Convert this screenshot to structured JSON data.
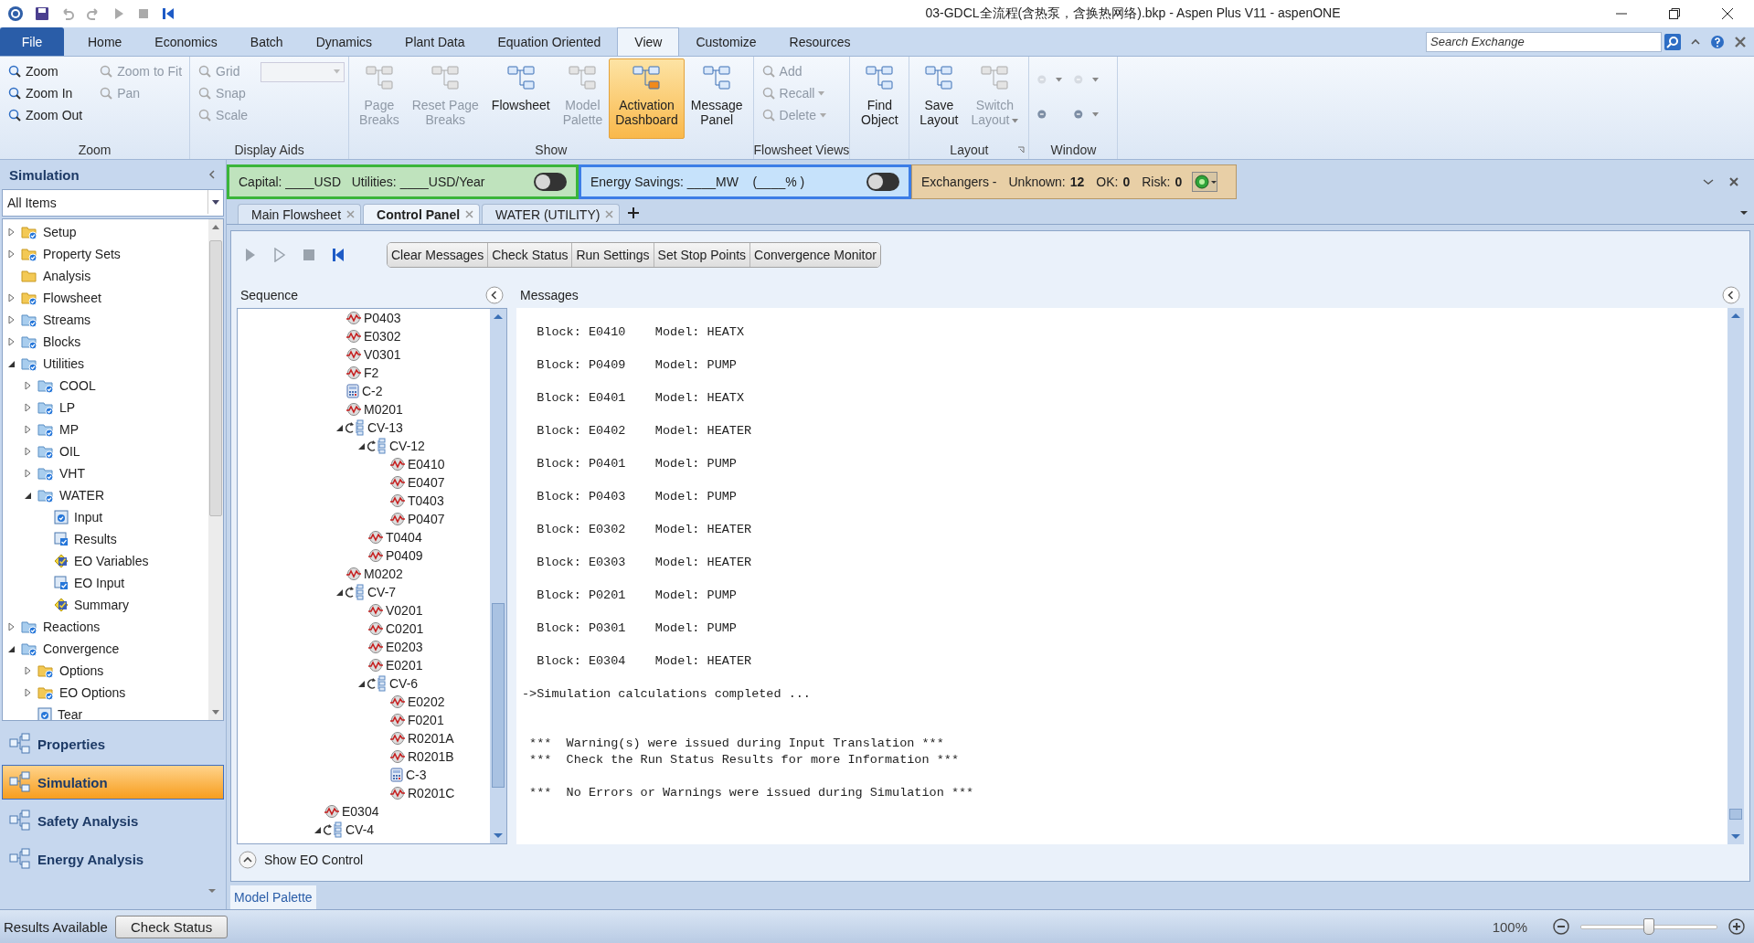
{
  "window": {
    "title": "03-GDCL全流程(含热泵，含换热网络).bkp - Aspen Plus V11 - aspenONE"
  },
  "ribbon_tabs": [
    {
      "label": "File",
      "kind": "file",
      "selected": false
    },
    {
      "label": "Home",
      "kind": "tab",
      "selected": false
    },
    {
      "label": "Economics",
      "kind": "tab",
      "selected": false
    },
    {
      "label": "Batch",
      "kind": "tab",
      "selected": false
    },
    {
      "label": "Dynamics",
      "kind": "tab",
      "selected": false
    },
    {
      "label": "Plant Data",
      "kind": "tab",
      "selected": false
    },
    {
      "label": "Equation Oriented",
      "kind": "tab",
      "selected": false
    },
    {
      "label": "View",
      "kind": "tab",
      "selected": true
    },
    {
      "label": "Customize",
      "kind": "tab",
      "selected": false
    },
    {
      "label": "Resources",
      "kind": "tab",
      "selected": false
    }
  ],
  "search": {
    "placeholder": "Search Exchange"
  },
  "ribbon_groups": [
    {
      "label": "Zoom",
      "kind": "small",
      "items": [
        {
          "label": "Zoom",
          "disabled": false
        },
        {
          "label": "Zoom In",
          "disabled": false
        },
        {
          "label": "Zoom Out",
          "disabled": false
        },
        {
          "label": "Zoom to Fit",
          "disabled": true
        },
        {
          "label": "Pan",
          "disabled": true
        }
      ]
    },
    {
      "label": "Display Aids",
      "kind": "small",
      "items": [
        {
          "label": "Grid",
          "disabled": true
        },
        {
          "label": "Snap",
          "disabled": true
        },
        {
          "label": "Scale",
          "disabled": true
        },
        {
          "kind": "combo",
          "disabled": true
        }
      ]
    },
    {
      "label": "Show",
      "kind": "large",
      "items": [
        {
          "label": "Page\nBreaks",
          "disabled": true,
          "selected": false
        },
        {
          "label": "Reset Page\nBreaks",
          "disabled": true,
          "selected": false
        },
        {
          "label": "Flowsheet",
          "disabled": false,
          "selected": false
        },
        {
          "label": "Model\nPalette",
          "disabled": true,
          "selected": false
        },
        {
          "label": "Activation\nDashboard",
          "disabled": false,
          "selected": true
        },
        {
          "label": "Message\nPanel",
          "disabled": false,
          "selected": false
        }
      ]
    },
    {
      "label": "Flowsheet Views",
      "kind": "small",
      "items": [
        {
          "label": "Add",
          "disabled": true
        },
        {
          "label": "Recall",
          "disabled": true,
          "dropdown": true
        },
        {
          "label": "Delete",
          "disabled": true,
          "dropdown": true
        }
      ]
    },
    {
      "kind": "large",
      "items": [
        {
          "label": "Find\nObject",
          "disabled": false,
          "selected": false
        }
      ]
    },
    {
      "label": "Layout",
      "kind": "large",
      "launcher": true,
      "items": [
        {
          "label": "Save\nLayout",
          "disabled": false,
          "selected": false
        },
        {
          "label": "Switch\nLayout",
          "disabled": true,
          "selected": false,
          "dropdown": true
        }
      ]
    },
    {
      "label": "Window",
      "kind": "icons",
      "items": [
        {
          "disabled": true,
          "dropdown": true
        },
        {
          "disabled": true,
          "dropdown": true
        },
        {
          "disabled": false
        },
        {
          "disabled": false,
          "dropdown": true
        }
      ]
    }
  ],
  "sidebar": {
    "title": "Simulation",
    "filter": "All Items",
    "tree": [
      {
        "label": "Setup",
        "kind": "folder",
        "expanded": false
      },
      {
        "label": "Property Sets",
        "kind": "folder",
        "expanded": false
      },
      {
        "label": "Analysis",
        "kind": "folder_plain"
      },
      {
        "label": "Flowsheet",
        "kind": "folder",
        "expanded": false
      },
      {
        "label": "Streams",
        "kind": "folder_blue",
        "expanded": false
      },
      {
        "label": "Blocks",
        "kind": "folder_blue",
        "expanded": false
      },
      {
        "label": "Utilities",
        "kind": "folder_blue",
        "expanded": true,
        "children": [
          {
            "label": "COOL",
            "kind": "folder_blue",
            "expanded": false
          },
          {
            "label": "LP",
            "kind": "folder_blue",
            "expanded": false
          },
          {
            "label": "MP",
            "kind": "folder_blue",
            "expanded": false
          },
          {
            "label": "OIL",
            "kind": "folder_blue",
            "expanded": false
          },
          {
            "label": "VHT",
            "kind": "folder_blue",
            "expanded": false
          },
          {
            "label": "WATER",
            "kind": "folder_blue",
            "expanded": true,
            "children": [
              {
                "label": "Input",
                "kind": "form"
              },
              {
                "label": "Results",
                "kind": "results"
              },
              {
                "label": "EO Variables",
                "kind": "eo"
              },
              {
                "label": "EO Input",
                "kind": "results"
              },
              {
                "label": "Summary",
                "kind": "eo"
              }
            ]
          }
        ]
      },
      {
        "label": "Reactions",
        "kind": "folder_blue",
        "expanded": false
      },
      {
        "label": "Convergence",
        "kind": "folder_blue",
        "expanded": true,
        "children": [
          {
            "label": "Options",
            "kind": "folder",
            "expanded": false
          },
          {
            "label": "EO Options",
            "kind": "folder",
            "expanded": false
          },
          {
            "label": "Tear",
            "kind": "form"
          }
        ]
      }
    ],
    "nav": [
      {
        "label": "Properties",
        "selected": false
      },
      {
        "label": "Simulation",
        "selected": true
      },
      {
        "label": "Safety Analysis",
        "selected": false
      },
      {
        "label": "Energy Analysis",
        "selected": false
      }
    ]
  },
  "dashboard": {
    "capital": {
      "text": "Capital: ____USD   Utilities: ____USD/Year",
      "on": false
    },
    "energy": {
      "text": "Energy Savings: ____MW    (____% )",
      "on": false
    },
    "exchangers": {
      "label": "Exchangers -",
      "unknown_label": "Unknown:",
      "unknown": "12",
      "ok_label": "OK:",
      "ok": "0",
      "risk_label": "Risk:",
      "risk": "0"
    }
  },
  "doc_tabs": [
    {
      "label": "Main Flowsheet",
      "selected": false
    },
    {
      "label": "Control Panel",
      "selected": true
    },
    {
      "label": "WATER (UTILITY)",
      "selected": false
    }
  ],
  "control_panel": {
    "buttons": [
      "Clear Messages",
      "Check Status",
      "Run Settings",
      "Set Stop Points",
      "Convergence Monitor"
    ],
    "sequence_title": "Sequence",
    "sequence": [
      {
        "children": [
          {
            "label": "P0403",
            "kind": "block"
          },
          {
            "label": "E0302",
            "kind": "block"
          },
          {
            "label": "V0301",
            "kind": "block"
          },
          {
            "label": "F2",
            "kind": "block"
          },
          {
            "label": "C-2",
            "kind": "calculator"
          },
          {
            "label": "M0201",
            "kind": "block"
          },
          {
            "label": "CV-13",
            "kind": "convergence",
            "expanded": true,
            "children": [
              {
                "label": "CV-12",
                "kind": "convergence",
                "expanded": true,
                "children": [
                  {
                    "label": "E0410",
                    "kind": "block"
                  },
                  {
                    "label": "E0407",
                    "kind": "block"
                  },
                  {
                    "label": "T0403",
                    "kind": "block"
                  },
                  {
                    "label": "P0407",
                    "kind": "block"
                  }
                ]
              },
              {
                "label": "T0404",
                "kind": "block"
              },
              {
                "label": "P0409",
                "kind": "block"
              }
            ]
          },
          {
            "label": "M0202",
            "kind": "block"
          },
          {
            "label": "CV-7",
            "kind": "convergence",
            "expanded": true,
            "children": [
              {
                "label": "V0201",
                "kind": "block"
              },
              {
                "label": "C0201",
                "kind": "block"
              },
              {
                "label": "E0203",
                "kind": "block"
              },
              {
                "label": "E0201",
                "kind": "block"
              },
              {
                "label": "CV-6",
                "kind": "convergence",
                "expanded": true,
                "children": [
                  {
                    "label": "E0202",
                    "kind": "block"
                  },
                  {
                    "label": "F0201",
                    "kind": "block"
                  },
                  {
                    "label": "R0201A",
                    "kind": "block"
                  },
                  {
                    "label": "R0201B",
                    "kind": "block"
                  },
                  {
                    "label": "C-3",
                    "kind": "calculator"
                  },
                  {
                    "label": "R0201C",
                    "kind": "block"
                  }
                ]
              }
            ]
          }
        ]
      },
      {
        "label": "E0304",
        "kind": "block"
      },
      {
        "label": "CV-4",
        "kind": "convergence",
        "expanded": true
      }
    ],
    "messages_title": "Messages",
    "messages": [
      {
        "kind": "line",
        "lines": [
          "  Block: E0410    Model: HEATX"
        ]
      },
      {
        "kind": "line",
        "lines": [
          "  Block: P0409    Model: PUMP"
        ]
      },
      {
        "kind": "line",
        "lines": [
          "  Block: E0401    Model: HEATX"
        ]
      },
      {
        "kind": "line",
        "lines": [
          "  Block: E0402    Model: HEATER"
        ]
      },
      {
        "kind": "line",
        "lines": [
          "  Block: P0401    Model: PUMP"
        ]
      },
      {
        "kind": "line",
        "lines": [
          "  Block: P0403    Model: PUMP"
        ]
      },
      {
        "kind": "line",
        "lines": [
          "  Block: E0302    Model: HEATER"
        ]
      },
      {
        "kind": "line",
        "lines": [
          "  Block: E0303    Model: HEATER"
        ]
      },
      {
        "kind": "line",
        "lines": [
          "  Block: P0201    Model: PUMP"
        ]
      },
      {
        "kind": "line",
        "lines": [
          "  Block: P0301    Model: PUMP"
        ]
      },
      {
        "kind": "line",
        "lines": [
          "  Block: E0304    Model: HEATER"
        ]
      },
      {
        "kind": "line",
        "lines": [
          "->Simulation calculations completed ..."
        ]
      },
      {
        "kind": "notice",
        "lines": [
          " ***  Warning(s) were issued during Input Translation ***",
          " ***  Check the Run Status Results for more Information ***"
        ]
      },
      {
        "kind": "line",
        "lines": [
          " ***  No Errors or Warnings were issued during Simulation ***"
        ]
      }
    ],
    "eo_toggle": "Show EO Control"
  },
  "bottom_tab": "Model Palette",
  "status_bar": {
    "text": "Results Available",
    "button": "Check Status",
    "zoom": "100%",
    "level": 0.5
  }
}
